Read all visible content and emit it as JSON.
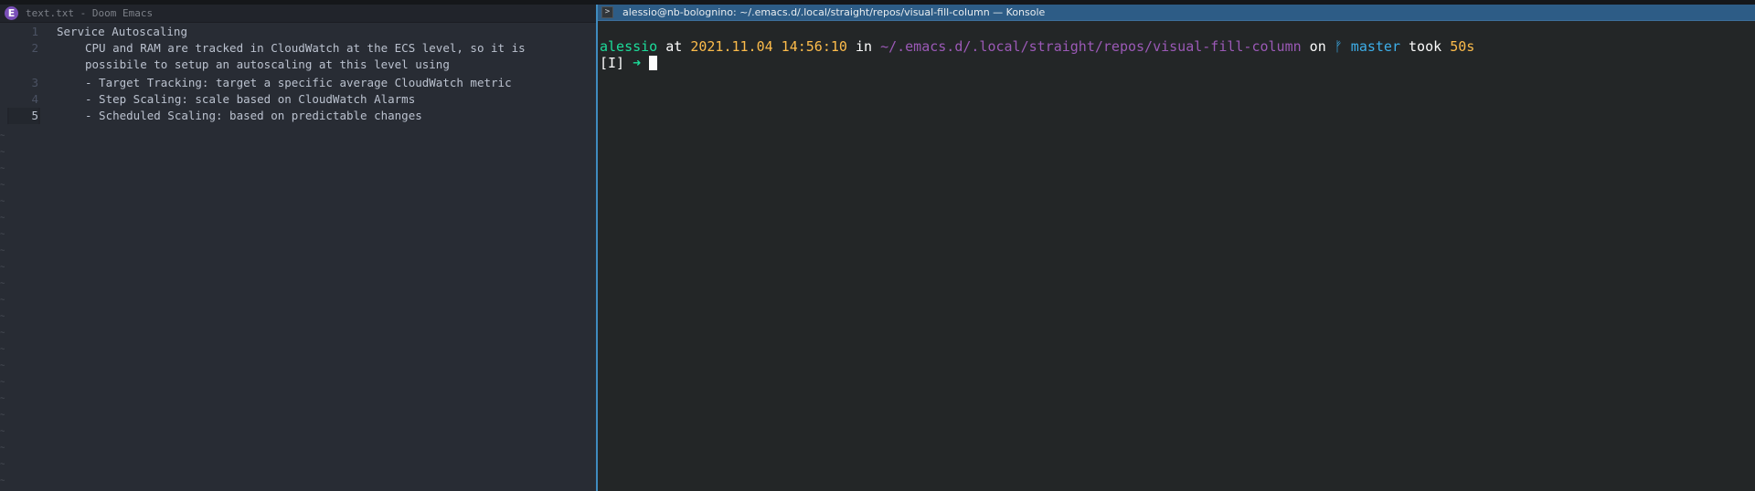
{
  "emacs": {
    "title": "text.txt - Doom Emacs",
    "logo_letter": "E",
    "icon": "doom-emacs-logo-icon",
    "current_line": "5",
    "lines": [
      {
        "number": "1",
        "text": "Service Autoscaling"
      },
      {
        "number": "2",
        "text": "CPU and RAM are tracked in CloudWatch at the ECS level, so it is"
      },
      {
        "number": "",
        "text": "possibile to setup an autoscaling at this level using"
      },
      {
        "number": "3",
        "text": "- Target Tracking: target a specific average CloudWatch metric"
      },
      {
        "number": "4",
        "text": "- Step Scaling: scale based on CloudWatch Alarms"
      },
      {
        "number": "5",
        "text": "- Scheduled Scaling: based on predictable changes"
      }
    ]
  },
  "konsole": {
    "title": "alessio@nb-bolognino: ~/.emacs.d/.local/straight/repos/visual-fill-column — Konsole",
    "icon": "terminal-icon",
    "icon_glyph": ">",
    "prompt": {
      "user": "alessio",
      "at": " at ",
      "datetime": "2021.11.04 14:56:10",
      "in": " in ",
      "path": "~/.emacs.d/.local/straight/repos/visual-fill-column",
      "on": " on ",
      "branch_icon": "ᚠ",
      "branch": " master",
      "took": " took ",
      "duration": "50s",
      "mode": "[I]",
      "arrow": " ➜ "
    }
  },
  "colors": {
    "accent": "#3f8bbf",
    "user": "#1cdc9a",
    "date": "#fdbc4b",
    "path": "#9b59b6",
    "branch": "#3daee9"
  }
}
